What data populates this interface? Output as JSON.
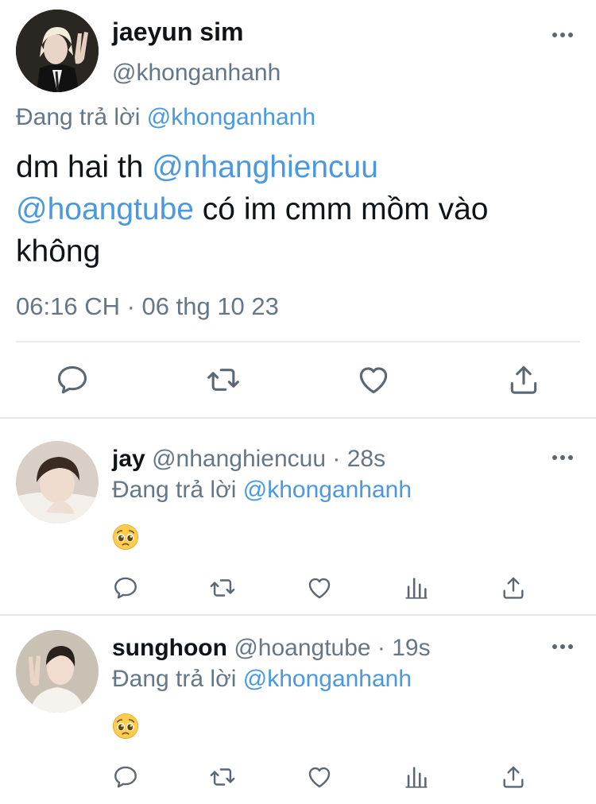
{
  "main_tweet": {
    "display_name": "jaeyun sim",
    "handle": "@khonganhanh",
    "replying_prefix": "Đang trả lời",
    "replying_to": "@khonganhanh",
    "text_start": "dm hai th ",
    "mention_1": "@nhanghiencuu",
    "mention_2": "@hoangtube",
    "text_end": " có im cmm mồm vào không",
    "timestamp": "06:16 CH · 06 thg 10 23",
    "actions": [
      "reply-icon",
      "retweet-icon",
      "like-icon",
      "share-icon"
    ]
  },
  "replies": [
    {
      "display_name": "jay",
      "handle": "@nhanghiencuu",
      "time": "· 28s",
      "replying_prefix": "Đang trả lời",
      "replying_to": "@khonganhanh",
      "content_emoji": "pleading-face-emoji"
    },
    {
      "display_name": "sunghoon",
      "handle": "@hoangtube",
      "time": "· 19s",
      "replying_prefix": "Đang trả lời",
      "replying_to": "@khonganhanh",
      "content_emoji": "pleading-face-emoji"
    }
  ],
  "colors": {
    "link": "#4a98e0",
    "muted": "#657786",
    "text": "#0f1419",
    "divider": "#e1e8ed"
  }
}
